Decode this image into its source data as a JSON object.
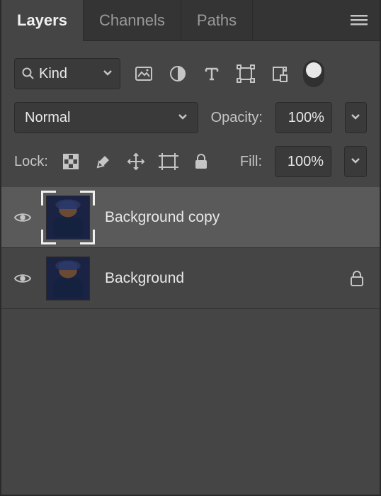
{
  "tabs": {
    "layers": "Layers",
    "channels": "Channels",
    "paths": "Paths"
  },
  "filter": {
    "kind": "Kind"
  },
  "blend": {
    "mode": "Normal",
    "opacity_label": "Opacity:",
    "opacity_value": "100%"
  },
  "lock": {
    "label": "Lock:",
    "fill_label": "Fill:",
    "fill_value": "100%"
  },
  "layers": [
    {
      "name": "Background copy",
      "locked": false,
      "selected": true
    },
    {
      "name": "Background",
      "locked": true,
      "selected": false
    }
  ]
}
